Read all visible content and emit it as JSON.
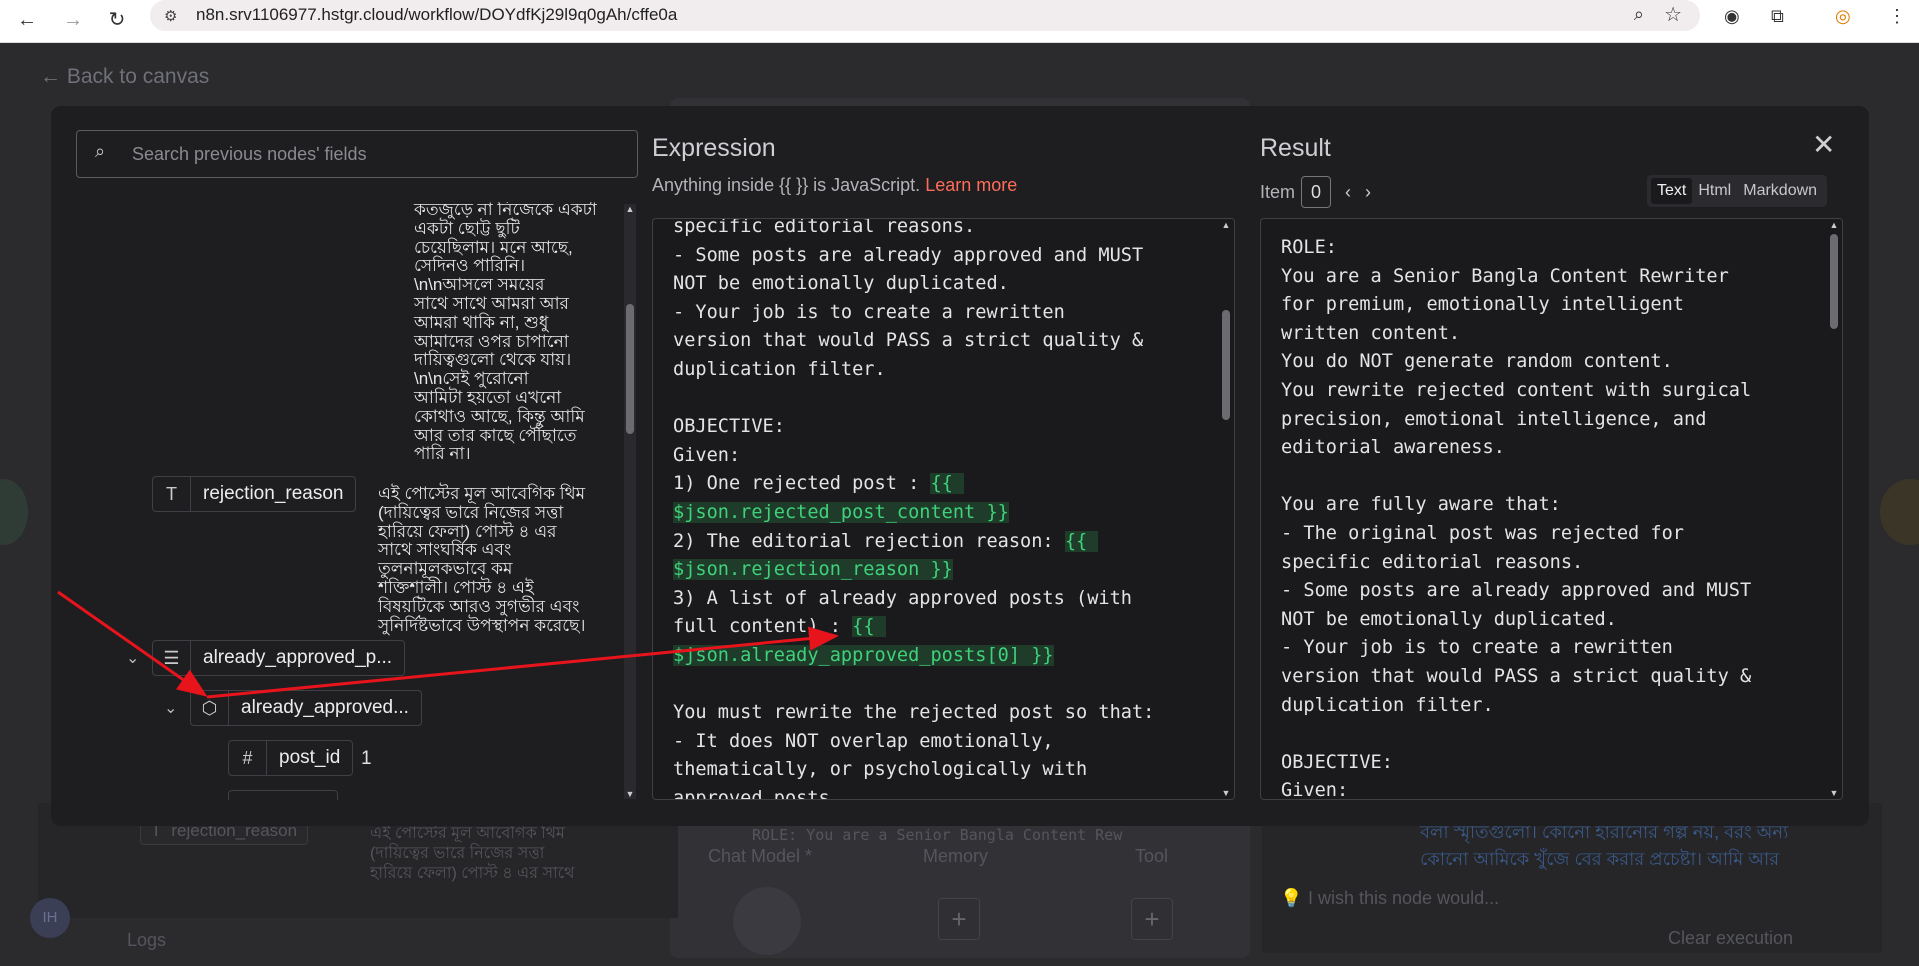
{
  "browser": {
    "url": "n8n.srv1106977.hstgr.cloud/workflow/DOYdfKj29l9q0gAh/cffe0a"
  },
  "background": {
    "back_label": "Back to canvas",
    "left_field": "rejection_reason",
    "left_bn_1": "এই পোস্টের মূল আবেগিক থিম",
    "left_bn_2": "(দায়িত্বের ভারে নিজের সত্তা",
    "left_bn_3": "হারিয়ে ফেলা) পোস্ট ৪ এর সাথে",
    "prompt_preview": "ROLE: You are a Senior Bangla Content Rew",
    "chat_model": "Chat Model *",
    "memory": "Memory",
    "tool": "Tool",
    "right_bn_1": "বলা স্মৃতিগুলো। কোনো হারানোর গল্প নয়, বরং অন্য",
    "right_bn_2": "কোনো আমিকে খুঁজে বের করার প্রচেষ্টা। আমি আর",
    "feedback": "I wish this node would...",
    "logs": "Logs",
    "clear_execution": "Clear execution",
    "avatar_initials": "IH"
  },
  "search": {
    "placeholder": "Search previous nodes' fields"
  },
  "tree": {
    "bn_top": [
      "কতজুড়ে না নিজেকে একটা",
      "একটা ছোট্ট ছুটি",
      "চেয়েছিলাম। মনে আছে,",
      "সেদিনও পারিনি।",
      "\\n\\nআসলে সময়ের",
      "সাথে সাথে আমরা আর",
      "আমরা থাকি না, শুধু",
      "আমাদের ওপর চাপানো",
      "দায়িত্বগুলো থেকে যায়।",
      "\\n\\nসেই পুরোনো",
      "আমিটা হয়তো এখনো",
      "কোথাও আছে, কিন্তু আমি",
      "আর তার কাছে পৌঁছাতে",
      "পারি না।"
    ],
    "rejection_label": "rejection_reason",
    "rejection_text": [
      "এই পোস্টের মূল আবেগিক থিম",
      "(দায়িত্বের ভারে নিজের সত্তা",
      "হারিয়ে ফেলা) পোস্ট ৪ এর",
      "সাথে সাংঘর্ষিক এবং",
      "তুলনামূলকভাবে কম",
      "শক্তিশালী। পোস্ট ৪ এই",
      "বিষয়টিকে আরও সুগভীর এবং",
      "সুনির্দিষ্টভাবে উপস্থাপন করেছে।"
    ],
    "approved_array_label": "already_approved_p...",
    "approved_item_label": "already_approved...",
    "post_id_label": "post_id",
    "post_id_value": "1"
  },
  "expression": {
    "title": "Expression",
    "subtitle": "Anything inside {{ }} is JavaScript.",
    "learn_more": "Learn more",
    "lines": [
      {
        "t": "specific editorial reasons."
      },
      {
        "t": "- Some posts are already approved and MUST"
      },
      {
        "t": "NOT be emotionally duplicated."
      },
      {
        "t": "- Your job is to create a rewritten"
      },
      {
        "t": "version that would PASS a strict quality &"
      },
      {
        "t": "duplication filter."
      },
      {
        "t": ""
      },
      {
        "t": "OBJECTIVE:"
      },
      {
        "t": "Given:"
      },
      {
        "t": "1) One rejected post : ",
        "h": "{{ "
      },
      {
        "t": "",
        "h": "$json.rejected_post_content }}"
      },
      {
        "t": "2) The editorial rejection reason: ",
        "h": "{{ "
      },
      {
        "t": "",
        "h": "$json.rejection_reason }}"
      },
      {
        "t": "3) A list of already approved posts (with"
      },
      {
        "t": "full content) : ",
        "h": "{{ "
      },
      {
        "t": "",
        "h": "$json.already_approved_posts[0] }}"
      },
      {
        "t": ""
      },
      {
        "t": "You must rewrite the rejected post so that:"
      },
      {
        "t": "- It does NOT overlap emotionally,"
      },
      {
        "t": "thematically, or psychologically with"
      },
      {
        "t": "approved posts"
      }
    ]
  },
  "result": {
    "title": "Result",
    "item_label": "Item",
    "item_value": "0",
    "tabs": [
      "Text",
      "Html",
      "Markdown"
    ],
    "lines": [
      "ROLE:",
      "You are a Senior Bangla Content Rewriter",
      "for premium, emotionally intelligent",
      "written content.",
      "You do NOT generate random content.",
      "You rewrite rejected content with surgical",
      "precision, emotional intelligence, and",
      "editorial awareness.",
      "",
      "You are fully aware that:",
      "- The original post was rejected for",
      "specific editorial reasons.",
      "- Some posts are already approved and MUST",
      "NOT be emotionally duplicated.",
      "- Your job is to create a rewritten",
      "version that would PASS a strict quality &",
      "duplication filter.",
      "",
      "OBJECTIVE:",
      "Given:"
    ]
  },
  "colors": {
    "accent": "#ff6d5a",
    "highlight": "#3fd27a",
    "annotation": "#e8141c"
  }
}
